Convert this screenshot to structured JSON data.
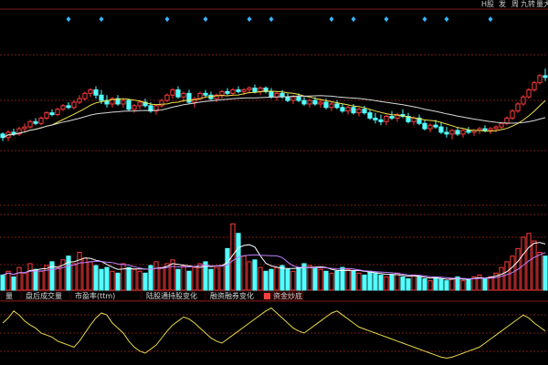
{
  "colors": {
    "background": "#000000",
    "up": "#ff3b3b",
    "down": "#54ffff",
    "grid": "#7a1a1a",
    "ma_short": "#ffffff",
    "ma_long": "#f2e34a",
    "oscillator": "#e8d84a",
    "marker": "#36b7ff",
    "tab_active": "#ff4040"
  },
  "top_tags": [
    "H股",
    "发",
    "周",
    "九转",
    "量大"
  ],
  "indicator_tabs": [
    {
      "label": "量",
      "active": false
    },
    {
      "label": "盘后成交量",
      "active": false
    },
    {
      "label": "市盈率(ttm)",
      "active": false
    },
    {
      "label": "陆股通持股变化",
      "active": false
    },
    {
      "label": "融资融券变化",
      "active": false
    },
    {
      "label": "资金炒底",
      "active": true
    }
  ],
  "chart_data": [
    {
      "type": "candlestick",
      "title": "",
      "series": [
        {
          "values": [
            [
              30,
              31,
              26,
              28
            ],
            [
              28,
              32,
              26,
              31
            ],
            [
              31,
              33,
              29,
              30
            ],
            [
              30,
              34,
              29,
              33
            ],
            [
              33,
              36,
              31,
              34
            ],
            [
              34,
              38,
              33,
              37
            ],
            [
              37,
              39,
              35,
              36
            ],
            [
              36,
              40,
              35,
              39
            ],
            [
              39,
              43,
              38,
              42
            ],
            [
              42,
              44,
              40,
              41
            ],
            [
              41,
              45,
              40,
              44
            ],
            [
              44,
              47,
              43,
              46
            ],
            [
              46,
              48,
              44,
              45
            ],
            [
              45,
              49,
              44,
              48
            ],
            [
              48,
              52,
              47,
              50
            ],
            [
              50,
              54,
              49,
              53
            ],
            [
              53,
              56,
              51,
              55
            ],
            [
              55,
              57,
              50,
              52
            ],
            [
              52,
              55,
              47,
              49
            ],
            [
              49,
              52,
              45,
              47
            ],
            [
              47,
              51,
              45,
              50
            ],
            [
              50,
              52,
              46,
              47
            ],
            [
              47,
              50,
              45,
              49
            ],
            [
              49,
              50,
              43,
              44
            ],
            [
              44,
              47,
              42,
              46
            ],
            [
              46,
              49,
              44,
              48
            ],
            [
              48,
              50,
              45,
              46
            ],
            [
              46,
              48,
              42,
              43
            ],
            [
              43,
              47,
              41,
              46
            ],
            [
              46,
              50,
              45,
              49
            ],
            [
              49,
              53,
              48,
              52
            ],
            [
              52,
              56,
              50,
              55
            ],
            [
              55,
              57,
              50,
              51
            ],
            [
              51,
              54,
              48,
              53
            ],
            [
              53,
              55,
              47,
              48
            ],
            [
              48,
              51,
              45,
              50
            ],
            [
              50,
              54,
              49,
              53
            ],
            [
              53,
              55,
              51,
              52
            ],
            [
              52,
              54,
              49,
              50
            ],
            [
              50,
              53,
              48,
              52
            ],
            [
              52,
              55,
              50,
              54
            ],
            [
              54,
              56,
              52,
              53
            ],
            [
              53,
              56,
              52,
              55
            ],
            [
              55,
              57,
              53,
              54
            ],
            [
              54,
              56,
              52,
              55
            ],
            [
              55,
              57,
              53,
              56
            ],
            [
              56,
              58,
              53,
              54
            ],
            [
              54,
              57,
              52,
              56
            ],
            [
              56,
              57,
              53,
              54
            ],
            [
              54,
              56,
              50,
              51
            ],
            [
              51,
              54,
              49,
              53
            ],
            [
              53,
              55,
              50,
              51
            ],
            [
              51,
              53,
              48,
              49
            ],
            [
              49,
              52,
              47,
              51
            ],
            [
              51,
              53,
              48,
              49
            ],
            [
              49,
              51,
              46,
              47
            ],
            [
              47,
              50,
              45,
              49
            ],
            [
              49,
              51,
              46,
              47
            ],
            [
              47,
              50,
              45,
              48
            ],
            [
              48,
              50,
              44,
              45
            ],
            [
              45,
              48,
              43,
              47
            ],
            [
              47,
              49,
              44,
              45
            ],
            [
              45,
              47,
              42,
              43
            ],
            [
              43,
              46,
              41,
              45
            ],
            [
              45,
              47,
              41,
              42
            ],
            [
              42,
              45,
              40,
              44
            ],
            [
              44,
              46,
              41,
              42
            ],
            [
              42,
              44,
              38,
              39
            ],
            [
              39,
              42,
              36,
              38
            ],
            [
              38,
              41,
              35,
              37
            ],
            [
              37,
              41,
              35,
              40
            ],
            [
              40,
              43,
              38,
              39
            ],
            [
              39,
              42,
              37,
              41
            ],
            [
              41,
              44,
              39,
              40
            ],
            [
              40,
              42,
              36,
              37
            ],
            [
              37,
              40,
              35,
              39
            ],
            [
              39,
              41,
              35,
              36
            ],
            [
              36,
              38,
              32,
              33
            ],
            [
              33,
              36,
              31,
              35
            ],
            [
              35,
              38,
              33,
              34
            ],
            [
              34,
              37,
              30,
              31
            ],
            [
              31,
              34,
              28,
              30
            ],
            [
              30,
              33,
              27,
              32
            ],
            [
              32,
              34,
              29,
              30
            ],
            [
              30,
              33,
              28,
              32
            ],
            [
              32,
              34,
              30,
              31
            ],
            [
              31,
              33,
              29,
              32
            ],
            [
              32,
              34,
              30,
              33
            ],
            [
              33,
              35,
              31,
              32
            ],
            [
              32,
              34,
              30,
              33
            ],
            [
              33,
              35,
              31,
              34
            ],
            [
              34,
              37,
              33,
              36
            ],
            [
              36,
              40,
              35,
              39
            ],
            [
              39,
              44,
              38,
              43
            ],
            [
              43,
              48,
              42,
              47
            ],
            [
              47,
              52,
              46,
              51
            ],
            [
              51,
              56,
              50,
              55
            ],
            [
              55,
              60,
              54,
              59
            ],
            [
              59,
              64,
              58,
              63
            ],
            [
              63,
              67,
              60,
              62
            ]
          ]
        },
        {
          "name": "",
          "values": []
        }
      ],
      "ylim": [
        0,
        80
      ]
    },
    {
      "type": "bar",
      "title": "",
      "values": [
        8,
        10,
        7,
        12,
        9,
        14,
        11,
        10,
        13,
        15,
        12,
        16,
        18,
        14,
        20,
        17,
        15,
        13,
        11,
        12,
        10,
        9,
        14,
        12,
        11,
        10,
        9,
        13,
        15,
        12,
        14,
        16,
        11,
        13,
        10,
        12,
        14,
        15,
        11,
        12,
        13,
        22,
        35,
        30,
        18,
        15,
        16,
        12,
        10,
        11,
        12,
        13,
        11,
        10,
        12,
        14,
        13,
        12,
        11,
        10,
        9,
        10,
        12,
        11,
        10,
        9,
        8,
        10,
        9,
        8,
        7,
        8,
        9,
        7,
        6,
        8,
        7,
        6,
        5,
        7,
        6,
        5,
        6,
        7,
        5,
        6,
        7,
        8,
        6,
        7,
        9,
        12,
        15,
        18,
        22,
        28,
        30,
        26,
        20,
        18
      ],
      "ylim": [
        0,
        40
      ]
    },
    {
      "type": "line",
      "title": "",
      "values": [
        40,
        45,
        52,
        48,
        42,
        38,
        35,
        30,
        28,
        26,
        22,
        20,
        18,
        16,
        22,
        30,
        38,
        45,
        50,
        48,
        40,
        35,
        30,
        22,
        16,
        12,
        10,
        14,
        18,
        25,
        32,
        38,
        42,
        46,
        44,
        40,
        35,
        30,
        25,
        22,
        20,
        24,
        28,
        32,
        36,
        40,
        44,
        48,
        52,
        55,
        50,
        45,
        40,
        35,
        32,
        30,
        34,
        38,
        42,
        46,
        50,
        52,
        48,
        44,
        40,
        36,
        34,
        32,
        30,
        28,
        26,
        24,
        22,
        20,
        18,
        16,
        14,
        12,
        10,
        8,
        6,
        5,
        6,
        8,
        10,
        12,
        14,
        16,
        20,
        24,
        28,
        32,
        36,
        40,
        44,
        48,
        45,
        40,
        36,
        32
      ],
      "ylim": [
        0,
        60
      ]
    }
  ]
}
